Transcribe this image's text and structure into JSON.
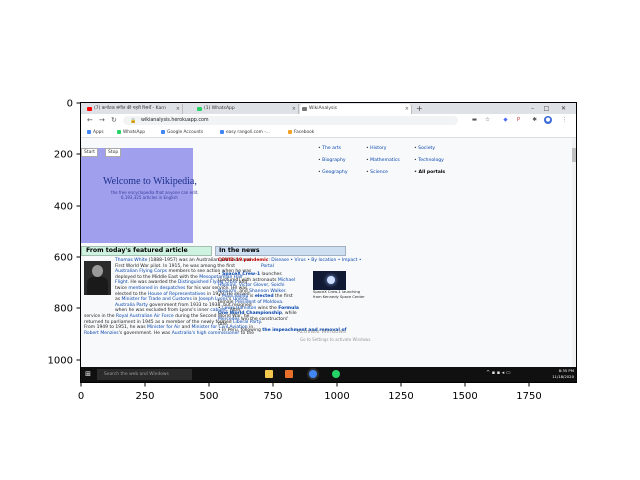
{
  "axes": {
    "x_ticks": [
      "0",
      "250",
      "500",
      "750",
      "1000",
      "1250",
      "1500",
      "1750"
    ],
    "y_ticks": [
      "0",
      "200",
      "400",
      "600",
      "800",
      "1000"
    ]
  },
  "browser": {
    "tabs": [
      {
        "label": "(7) कर्नाटक संगीत की गहरी रिसर्चें - Karn",
        "color": "#ff0000"
      },
      {
        "label": "(1) WhatsApp",
        "color": "#25d366"
      },
      {
        "label": "WikiAnalysis",
        "color": "#777777"
      }
    ],
    "new_tab": "+",
    "window_buttons": [
      "–",
      "□",
      "✕"
    ],
    "url": "wikianalysis.herokuapp.com",
    "bookmarks": [
      {
        "label": "Apps",
        "color": "#4285f4"
      },
      {
        "label": "WhatsApp",
        "color": "#25d366"
      },
      {
        "label": "Google Accounts",
        "color": "#4285f4"
      },
      {
        "label": "easy rangoli.com -...",
        "color": "#4285f4"
      },
      {
        "label": "Facebook",
        "color": "#f4a020"
      }
    ]
  },
  "page": {
    "start_button": "Start",
    "stop_button": "Stop",
    "welcome": "Welcome to Wikipedia,",
    "free_encyclopedia": "the free encyclopedia that anyone can edit.",
    "article_count": "6,193,325 articles in English",
    "portals": {
      "col1": [
        "The arts",
        "Biography",
        "Geography"
      ],
      "col2": [
        "History",
        "Mathematics",
        "Science"
      ],
      "col3": [
        "Society",
        "Technology",
        "All portals"
      ]
    },
    "featured": {
      "heading": "From today's featured article",
      "image_caption": "person",
      "lines": [
        [
          {
            "t": "Thomas White",
            "c": "a"
          },
          {
            "t": " (1888–1957) was an Australian politician and",
            "c": ""
          }
        ],
        [
          {
            "t": "First World War pilot. In 1915, he was among the first",
            "c": ""
          }
        ],
        [
          {
            "t": "Australian Flying Corps",
            "c": "a"
          },
          {
            "t": " members to see action when he was",
            "c": ""
          }
        ],
        [
          {
            "t": "deployed to the Middle East with the ",
            "c": ""
          },
          {
            "t": "Mesopotamian Half",
            "c": "a"
          }
        ],
        [
          {
            "t": "Flight",
            "c": "a"
          },
          {
            "t": ". He was awarded the ",
            "c": ""
          },
          {
            "t": "Distinguished Flying Cross",
            "c": "a"
          },
          {
            "t": " and",
            "c": ""
          }
        ],
        [
          {
            "t": "twice ",
            "c": ""
          },
          {
            "t": "mentioned in despatches",
            "c": "a"
          },
          {
            "t": " for his war service. He was",
            "c": ""
          }
        ],
        [
          {
            "t": "elected to the ",
            "c": ""
          },
          {
            "t": "House of Representatives",
            "c": "a"
          },
          {
            "t": " in 1929. He served",
            "c": ""
          }
        ],
        [
          {
            "t": "as ",
            "c": ""
          },
          {
            "t": "Minister for Trade and Customs",
            "c": "a"
          },
          {
            "t": " in ",
            "c": ""
          },
          {
            "t": "Joseph Lyons",
            "c": "a"
          },
          {
            "t": "'s ",
            "c": ""
          },
          {
            "t": "United",
            "c": "a"
          }
        ],
        [
          {
            "t": "Australia Party",
            "c": "a"
          },
          {
            "t": " government from 1933 to 1938, but resigned",
            "c": ""
          }
        ],
        [
          {
            "t": "when he was excluded from Lyons's inner ",
            "c": ""
          },
          {
            "t": "cabinet",
            "c": "a"
          },
          {
            "t": ". After",
            "c": ""
          }
        ],
        [
          {
            "t": "service in the ",
            "c": ""
          },
          {
            "t": "Royal Australian Air Force",
            "c": "a"
          },
          {
            "t": " during the Second World War, he",
            "c": ""
          }
        ],
        [
          {
            "t": "returned to parliament in 1945 as a member of the newly formed ",
            "c": ""
          },
          {
            "t": "Liberal Party",
            "c": "a"
          },
          {
            "t": ".",
            "c": ""
          }
        ],
        [
          {
            "t": "From 1949 to 1951, he was ",
            "c": ""
          },
          {
            "t": "Minister for Air",
            "c": "a"
          },
          {
            "t": " and ",
            "c": ""
          },
          {
            "t": "Minister for Civil Aviation",
            "c": "a"
          },
          {
            "t": " in",
            "c": ""
          }
        ],
        [
          {
            "t": "Robert Menzies",
            "c": "a"
          },
          {
            "t": "'s government. He was ",
            "c": ""
          },
          {
            "t": "Australia's high commissioner",
            "c": "a"
          },
          {
            "t": " to the",
            "c": ""
          }
        ]
      ]
    },
    "news": {
      "heading": "In the news",
      "covid_line": [
        {
          "t": "COVID-19 pandemic",
          "c": "red bld"
        },
        {
          "t": ": Disease • Virus • By location • Impact •",
          "c": "a"
        }
      ],
      "covid_line2": "Portal",
      "image_caption": "SpaceX Crew-1 launching",
      "image_caption2": "from Kennedy Space Center",
      "lines": [
        [
          {
            "t": "• ",
            "c": ""
          },
          {
            "t": "SpaceX Crew-1",
            "c": "a bld"
          },
          {
            "t": " launches",
            "c": ""
          }
        ],
        [
          {
            "t": "  (pictured)",
            "c": ""
          },
          {
            "t": " with astronauts ",
            "c": ""
          },
          {
            "t": "Michael",
            "c": "a"
          }
        ],
        [
          {
            "t": "  Hopkins",
            "c": "a"
          },
          {
            "t": ", ",
            "c": ""
          },
          {
            "t": "Victor Glover",
            "c": "a"
          },
          {
            "t": ", ",
            "c": ""
          },
          {
            "t": "Soichi",
            "c": "a"
          }
        ],
        [
          {
            "t": "  Noguchi",
            "c": "a"
          },
          {
            "t": ", and ",
            "c": ""
          },
          {
            "t": "Shannon Walker",
            "c": "a"
          },
          {
            "t": ".",
            "c": ""
          }
        ],
        [
          {
            "t": "• ",
            "c": ""
          },
          {
            "t": "Maia Sandu",
            "c": "a"
          },
          {
            "t": " is ",
            "c": ""
          },
          {
            "t": "elected",
            "c": "a bld"
          },
          {
            "t": " the first",
            "c": ""
          }
        ],
        [
          {
            "t": "  female ",
            "c": ""
          },
          {
            "t": "President of Moldova",
            "c": "a"
          },
          {
            "t": ".",
            "c": ""
          }
        ],
        [
          {
            "t": "• ",
            "c": ""
          },
          {
            "t": "Lewis Hamilton",
            "c": "a"
          },
          {
            "t": " wins the ",
            "c": ""
          },
          {
            "t": "Formula",
            "c": "a bld"
          }
        ],
        [
          {
            "t": "  One World Championship",
            "c": "a bld"
          },
          {
            "t": ", while",
            "c": ""
          }
        ],
        [
          {
            "t": "  Mercedes",
            "c": "a"
          },
          {
            "t": " win the constructors'",
            "c": ""
          }
        ],
        [
          {
            "t": "  title.",
            "c": ""
          }
        ],
        [
          {
            "t": "• In Peru, following ",
            "c": ""
          },
          {
            "t": "the impeachment and removal of",
            "c": "a bld"
          }
        ]
      ]
    },
    "activate_windows": "Activate Windows",
    "activate_windows_sub": "Go to Settings to activate Windows."
  },
  "taskbar": {
    "search_placeholder": "Search the web and Windows",
    "time": "8:35 PM",
    "date": "11/18/2020",
    "apps": [
      {
        "name": "file-explorer-icon",
        "color": "#f2c94c"
      },
      {
        "name": "office-icon",
        "color": "#e8702a"
      },
      {
        "name": "chrome-icon",
        "color": "#4285f4"
      },
      {
        "name": "whatsapp-icon",
        "color": "#25d366"
      }
    ]
  }
}
